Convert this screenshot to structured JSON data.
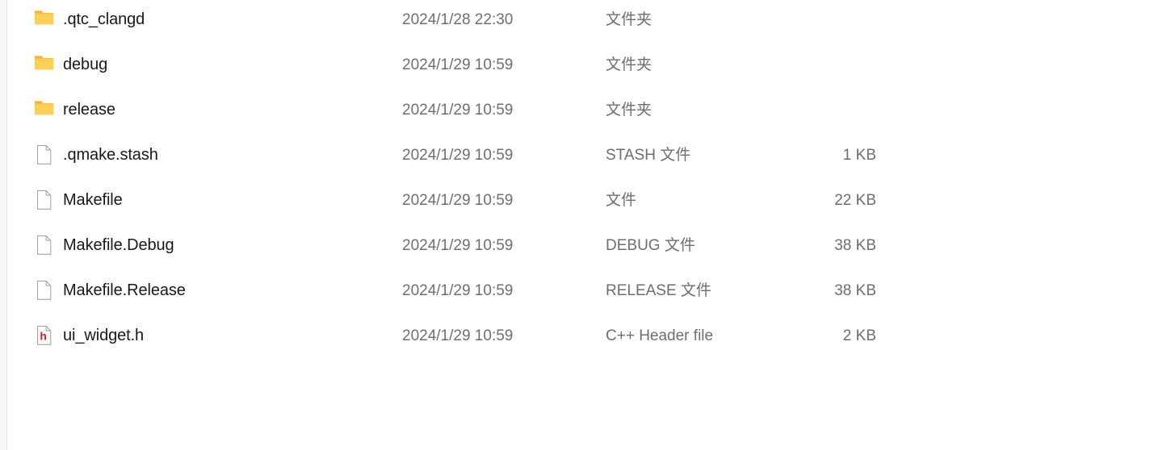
{
  "view": {
    "type": "file-explorer-details-list",
    "background_color": "#ffffff",
    "name_text_color": "#191919",
    "meta_text_color": "#6e6e6e",
    "divider_color": "#e4e4e4",
    "folder_icon_color": "#ffcf5a",
    "folder_icon_shade_color": "#f5b940",
    "file_icon_color": "#ffffff",
    "file_icon_border_color": "#a6a6a6",
    "header_icon_letter_color": "#cc2229"
  },
  "rows": [
    {
      "name": ".qtc_clangd",
      "date": "2024/1/28 22:30",
      "type": "文件夹",
      "size": "",
      "icon": "folder-icon"
    },
    {
      "name": "debug",
      "date": "2024/1/29 10:59",
      "type": "文件夹",
      "size": "",
      "icon": "folder-icon"
    },
    {
      "name": "release",
      "date": "2024/1/29 10:59",
      "type": "文件夹",
      "size": "",
      "icon": "folder-icon"
    },
    {
      "name": ".qmake.stash",
      "date": "2024/1/29 10:59",
      "type": "STASH 文件",
      "size": "1 KB",
      "icon": "generic-file-icon"
    },
    {
      "name": "Makefile",
      "date": "2024/1/29 10:59",
      "type": "文件",
      "size": "22 KB",
      "icon": "generic-file-icon"
    },
    {
      "name": "Makefile.Debug",
      "date": "2024/1/29 10:59",
      "type": "DEBUG 文件",
      "size": "38 KB",
      "icon": "generic-file-icon"
    },
    {
      "name": "Makefile.Release",
      "date": "2024/1/29 10:59",
      "type": "RELEASE 文件",
      "size": "38 KB",
      "icon": "generic-file-icon"
    },
    {
      "name": "ui_widget.h",
      "date": "2024/1/29 10:59",
      "type": "C++ Header file",
      "size": "2 KB",
      "icon": "cpp-header-file-icon",
      "icon_letter": "h"
    }
  ]
}
